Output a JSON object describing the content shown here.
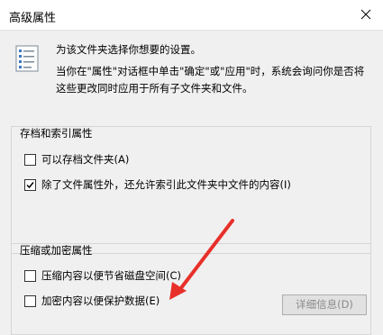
{
  "window": {
    "title": "高级属性",
    "close_label": "×"
  },
  "intro": {
    "line1": "为该文件夹选择你想要的设置。",
    "line2": "当你在\"属性\"对话框中单击\"确定\"或\"应用\"时，系统会询问你是否将这些更改同时应用于所有子文件夹和文件。"
  },
  "archive_group": {
    "title": "存档和索引属性",
    "options": [
      {
        "label": "可以存档文件夹(A)",
        "checked": false
      },
      {
        "label": "除了文件属性外，还允许索引此文件夹中文件的内容(I)",
        "checked": true
      }
    ]
  },
  "compress_group": {
    "title": "压缩或加密属性",
    "options": [
      {
        "label": "压缩内容以便节省磁盘空间(C)",
        "checked": false
      },
      {
        "label": "加密内容以便保护数据(E)",
        "checked": false
      }
    ],
    "details_button": "详细信息(D)"
  },
  "annotation": {
    "color": "#e8302a"
  }
}
